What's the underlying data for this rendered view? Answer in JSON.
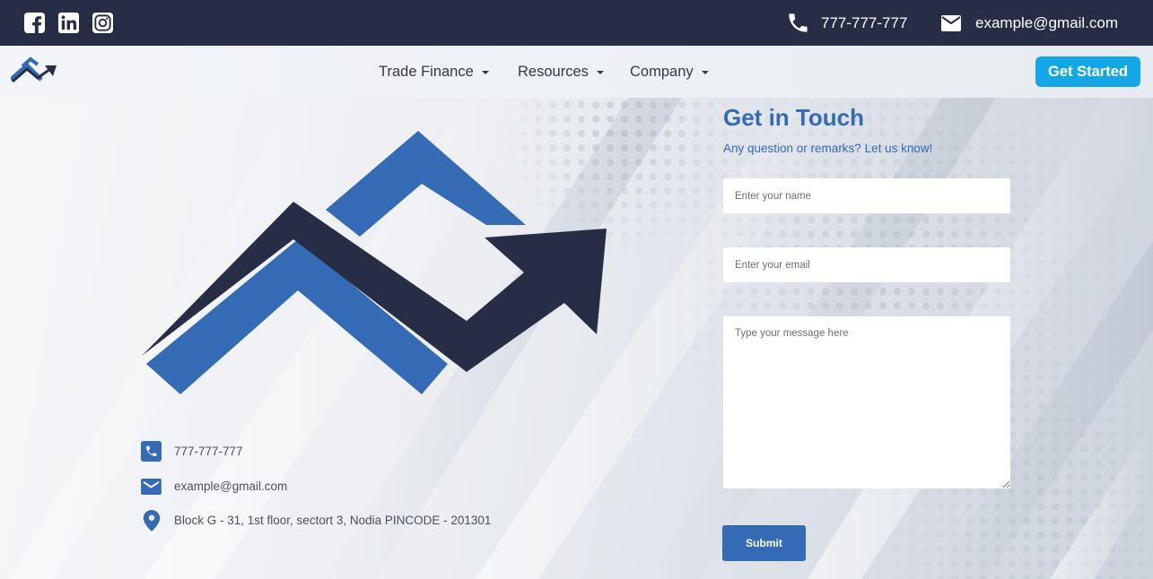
{
  "topbar": {
    "phone": "777-777-777",
    "email": "example@gmail.com",
    "social": [
      "facebook-icon",
      "linkedin-icon",
      "instagram-icon"
    ]
  },
  "nav": {
    "items": [
      {
        "label": "Trade Finance"
      },
      {
        "label": "Resources"
      },
      {
        "label": "Company"
      }
    ],
    "cta_label": "Get Started"
  },
  "contact": {
    "phone": "777-777-777",
    "email": "example@gmail.com",
    "address": "Block G - 31, 1st floor, sectort 3, Nodia PINCODE - 201301"
  },
  "form": {
    "title": "Get in Touch",
    "subtitle": "Any question or remarks? Let us know!",
    "name_placeholder": "Enter your name",
    "email_placeholder": "Enter your email",
    "message_placeholder": "Type your message here",
    "submit_label": "Submit"
  },
  "colors": {
    "topbar": "#262d45",
    "brand_blue": "#356ab5",
    "brand_navy": "#262d45",
    "cta": "#15a6e6"
  }
}
